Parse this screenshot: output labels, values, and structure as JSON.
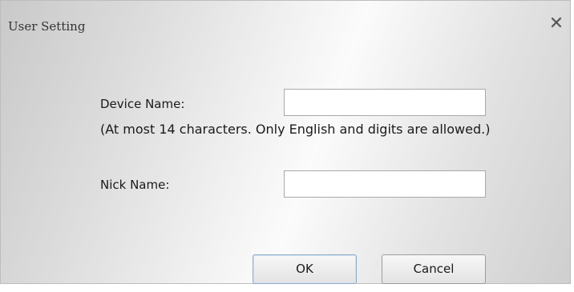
{
  "window": {
    "title": "User Setting",
    "close_icon": "close-icon",
    "close_glyph": "✕"
  },
  "form": {
    "device_name": {
      "label": "Device Name:",
      "value": "",
      "hint": "(At most 14 characters. Only English and digits are allowed.)"
    },
    "nick_name": {
      "label": "Nick Name:",
      "value": ""
    }
  },
  "buttons": {
    "ok_label": "OK",
    "cancel_label": "Cancel"
  }
}
